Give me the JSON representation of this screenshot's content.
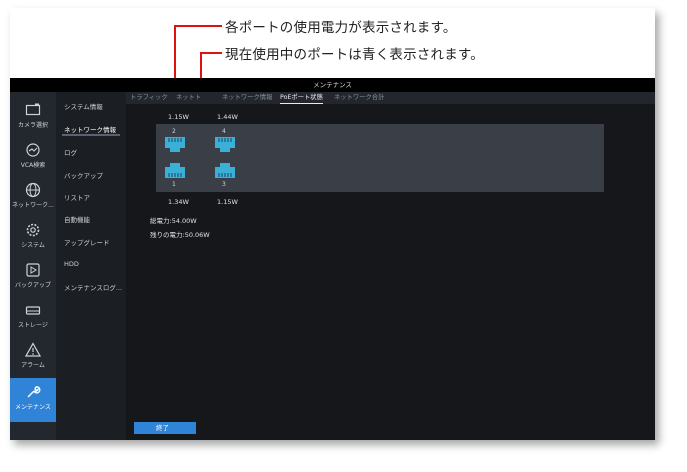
{
  "callouts": {
    "line1": "各ポートの使用電力が表示されます。",
    "line2": "現在使用中のポートは青く表示されます。"
  },
  "window": {
    "title": "メンテナンス"
  },
  "nav": [
    {
      "label": "カメラ選択",
      "icon": "camera-icon"
    },
    {
      "label": "VCA検索",
      "icon": "vca-search-icon"
    },
    {
      "label": "ネットワーク...",
      "icon": "globe-icon"
    },
    {
      "label": "システム",
      "icon": "gear-icon"
    },
    {
      "label": "バックアップ",
      "icon": "backup-icon"
    },
    {
      "label": "ストレージ",
      "icon": "storage-icon"
    },
    {
      "label": "アラーム",
      "icon": "alarm-icon"
    },
    {
      "label": "メンテナンス",
      "icon": "wrench-icon"
    }
  ],
  "submenu": [
    "システム情報",
    "ネットワーク情報",
    "ログ",
    "バックアップ",
    "リストア",
    "自動機能",
    "アップグレード",
    "HDD",
    "メンテナンスログ..."
  ],
  "tabs": [
    "トラフィック",
    "ネットト",
    "ネットワーク情報",
    "PoEポート状態",
    "ネットワーク合計"
  ],
  "ports": [
    {
      "number": "2",
      "power": "1.15W"
    },
    {
      "number": "4",
      "power": "1.44W"
    },
    {
      "number": "1",
      "power": "1.34W"
    },
    {
      "number": "3",
      "power": "1.15W"
    }
  ],
  "summary": {
    "total": "総電力:54.00W",
    "remaining": "残りの電力:50.06W"
  },
  "buttons": {
    "exit": "終了"
  },
  "colors": {
    "accent": "#2f84d8",
    "port_active": "#3ab0d6",
    "callout_line": "#e01010"
  }
}
